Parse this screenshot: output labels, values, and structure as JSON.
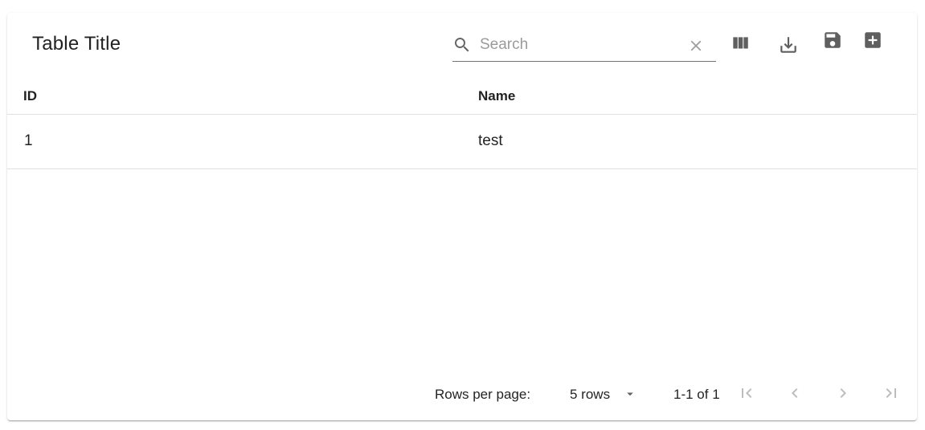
{
  "table": {
    "title": "Table Title"
  },
  "search": {
    "placeholder": "Search",
    "value": ""
  },
  "toolbar": {
    "icons": [
      "search-icon",
      "clear-icon",
      "view-column-icon",
      "download-icon",
      "save-icon",
      "add-box-icon"
    ]
  },
  "columns": [
    "ID",
    "Name"
  ],
  "rows": [
    {
      "id": "1",
      "name": "test"
    }
  ],
  "pagination": {
    "rows_per_page_label": "Rows per page:",
    "rows_per_page_value": "5 rows",
    "range": "1-1 of 1",
    "icons": [
      "first-page-icon",
      "previous-page-icon",
      "next-page-icon",
      "last-page-icon"
    ]
  },
  "colors": {
    "text": "#212121",
    "icon_active": "#5f5f5f",
    "icon_disabled": "#bdbdbd",
    "divider": "#e0e0e0"
  }
}
